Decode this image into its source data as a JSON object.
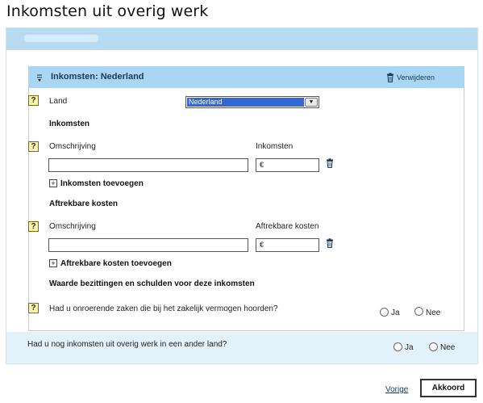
{
  "page": {
    "title": "Inkomsten uit overig werk"
  },
  "section": {
    "title": "Inkomsten: Nederland",
    "delete_label": "Verwijderen"
  },
  "country": {
    "help": "?",
    "label": "Land",
    "selected": "Nederland"
  },
  "income": {
    "heading": "Inkomsten",
    "help": "?",
    "description_label": "Omschrijving",
    "amount_label": "Inkomsten",
    "currency": "€",
    "add_label": "Inkomsten toevoegen"
  },
  "costs": {
    "heading": "Aftrekbare kosten",
    "help": "?",
    "description_label": "Omschrijving",
    "amount_label": "Aftrekbare kosten",
    "currency": "€",
    "add_label": "Aftrekbare kosten toevoegen"
  },
  "assets": {
    "heading": "Waarde bezittingen en schulden voor deze inkomsten",
    "help": "?",
    "question": "Had u onroerende zaken die bij het zakelijk vermogen hoorden?",
    "yes": "Ja",
    "no": "Nee"
  },
  "other_country": {
    "question": "Had u nog inkomsten uit overig werk in een ander land?",
    "yes": "Ja",
    "no": "Nee"
  },
  "footer": {
    "previous_label": "Vorige",
    "accept_label": "Akkoord"
  },
  "colors": {
    "band": "#b7dcf2",
    "header": "#a9d6f2",
    "outer_bg": "#e3f1fb",
    "select_highlight": "#3367d6",
    "help_bg": "#fff7b0"
  }
}
